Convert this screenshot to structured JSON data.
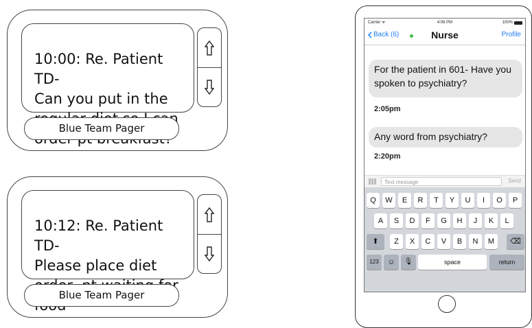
{
  "pagers": [
    {
      "message": "10:00: Re. Patient TD-\nCan you put in the\nregular diet so I can\norder pt breakfast?",
      "label": "Blue Team Pager",
      "up_icon": "up-arrow-icon",
      "down_icon": "down-arrow-icon"
    },
    {
      "message": "10:12: Re. Patient TD-\nPlease place diet\norder, pt waiting for\nfood",
      "label": "Blue Team Pager",
      "up_icon": "up-arrow-icon",
      "down_icon": "down-arrow-icon"
    }
  ],
  "phone": {
    "status": {
      "carrier": "Carrier ᯤ",
      "time": "4:06 PM",
      "battery": "100%"
    },
    "nav": {
      "back": "Back (6)",
      "title": "Nurse",
      "profile": "Profile"
    },
    "messages": [
      {
        "text": "For the patient in 601- Have you spoken to psychiatry?",
        "time": "2:05pm"
      },
      {
        "text": "Any word from psychiatry?",
        "time": "2:20pm"
      }
    ],
    "input": {
      "placeholder": "Text message",
      "send": "Send"
    },
    "keyboard": {
      "row1": [
        "Q",
        "W",
        "E",
        "R",
        "T",
        "Y",
        "U",
        "I",
        "O",
        "P"
      ],
      "row2": [
        "A",
        "S",
        "D",
        "F",
        "G",
        "H",
        "J",
        "K",
        "L"
      ],
      "row3": [
        "Z",
        "X",
        "C",
        "V",
        "B",
        "N",
        "M"
      ],
      "shift": "⬆",
      "delete": "⌫",
      "numbers": "123",
      "emoji": "☺",
      "mic": "🎙",
      "space": "space",
      "return": "return"
    }
  },
  "colors": {
    "ios_blue": "#1a7cf5",
    "online_green": "#3ec23e",
    "bubble": "#e6e6e6"
  }
}
